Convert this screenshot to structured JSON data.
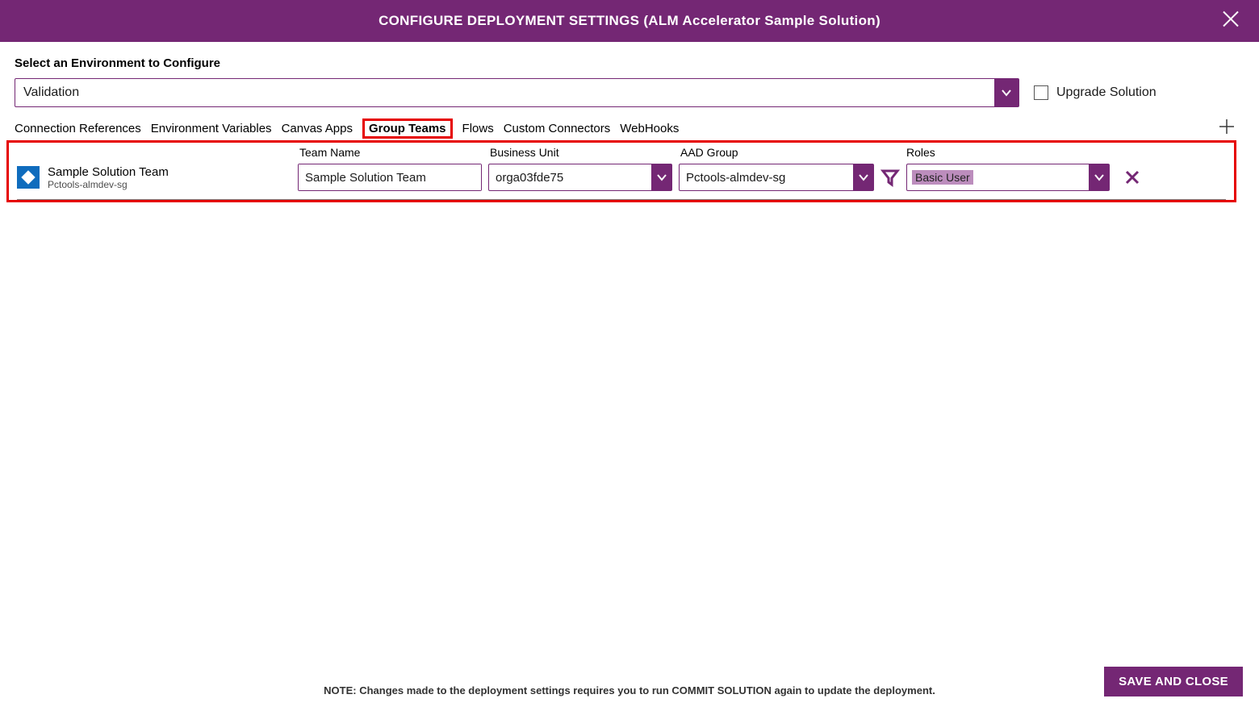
{
  "header": {
    "title": "CONFIGURE DEPLOYMENT SETTINGS (ALM Accelerator Sample Solution)"
  },
  "env": {
    "label": "Select an Environment to Configure",
    "selected": "Validation"
  },
  "upgrade": {
    "label": "Upgrade Solution",
    "checked": false
  },
  "tabs": {
    "items": [
      {
        "label": "Connection References",
        "active": false
      },
      {
        "label": "Environment Variables",
        "active": false
      },
      {
        "label": "Canvas Apps",
        "active": false
      },
      {
        "label": "Group Teams",
        "active": true
      },
      {
        "label": "Flows",
        "active": false
      },
      {
        "label": "Custom Connectors",
        "active": false
      },
      {
        "label": "WebHooks",
        "active": false
      }
    ]
  },
  "columns": {
    "team_name": "Team Name",
    "business_unit": "Business Unit",
    "aad_group": "AAD Group",
    "roles": "Roles"
  },
  "rows": [
    {
      "title": "Sample Solution Team",
      "subtitle": "Pctools-almdev-sg",
      "team_name": "Sample Solution Team",
      "business_unit": "orga03fde75",
      "aad_group": "Pctools-almdev-sg",
      "role": "Basic User"
    }
  ],
  "footer": {
    "note": "NOTE: Changes made to the deployment settings requires you to run COMMIT SOLUTION again to update the deployment.",
    "save": "SAVE AND CLOSE"
  },
  "theme": {
    "primary": "#742774",
    "highlight_red": "#e60000"
  }
}
